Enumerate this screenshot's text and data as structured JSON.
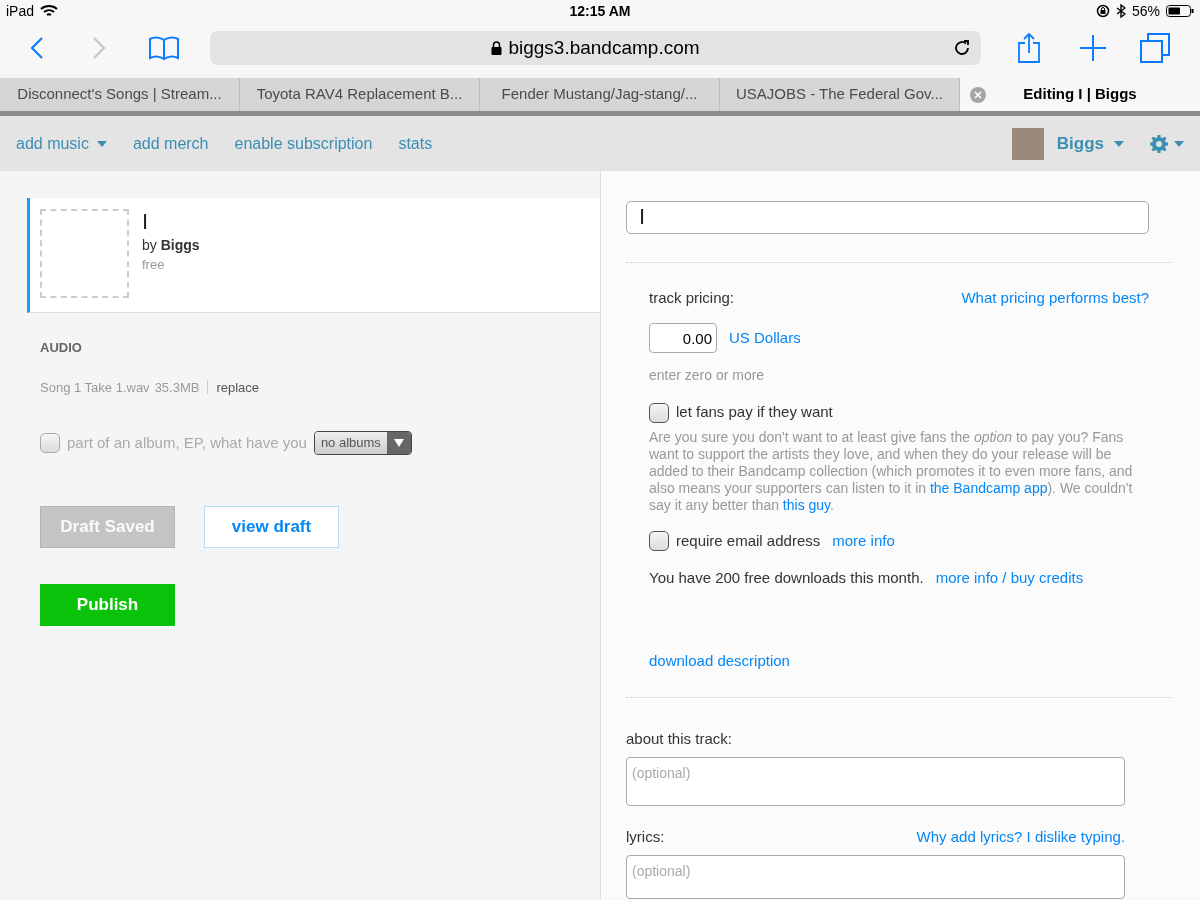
{
  "status_bar": {
    "device": "iPad",
    "time": "12:15 AM",
    "battery": "56%"
  },
  "browser": {
    "url": "biggs3.bandcamp.com"
  },
  "tabs": [
    {
      "label": "Disconnect's Songs | Stream...",
      "selected": false
    },
    {
      "label": "Toyota RAV4 Replacement B...",
      "selected": false
    },
    {
      "label": "Fender Mustang/Jag-stang/...",
      "selected": false
    },
    {
      "label": "USAJOBS - The Federal Gov...",
      "selected": false
    },
    {
      "label": "Editing I | Biggs",
      "selected": true
    }
  ],
  "nav": {
    "items": [
      {
        "label": "add music",
        "dropdown": true
      },
      {
        "label": "add merch",
        "dropdown": false
      },
      {
        "label": "enable subscription",
        "dropdown": false
      },
      {
        "label": "stats",
        "dropdown": false
      }
    ],
    "user": "Biggs"
  },
  "track_card": {
    "title": "I",
    "by": "by **Biggs**",
    "price": "free"
  },
  "audio": {
    "heading": "AUDIO",
    "file": "Song 1 Take 1.wav",
    "size": "35.3MB",
    "replace": "replace"
  },
  "album": {
    "label": "part of an album, EP, what have you",
    "checked": false,
    "disabled": true,
    "select": "no albums"
  },
  "buttons": {
    "draft": {
      "label": "Draft Saved",
      "disabled": true
    },
    "view": "view draft",
    "publish": "Publish"
  },
  "title_field": {
    "value": "I"
  },
  "pricing": {
    "label": "track pricing:",
    "help_link": "What pricing performs best?",
    "amount": "0.00",
    "currency": "US Dollars",
    "hint": "enter zero or more"
  },
  "options": [
    {
      "label": "let fans pay if they want",
      "checked": false
    },
    {
      "label": "require email address",
      "checked": false,
      "link": "more info"
    }
  ],
  "pay_note": [
    {
      "kind": "text",
      "text": "Are you sure you don't want to at least give fans the *option* to pay you? Fans want to support the artists they love, and when they do your release will be added to their Bandcamp collection (which promotes it to even more fans, and also means your supporters can listen to it in "
    },
    {
      "kind": "link",
      "text": "the Bandcamp app"
    },
    {
      "kind": "text",
      "text": "). We couldn't say it any better than "
    },
    {
      "kind": "link",
      "text": "this guy"
    },
    {
      "kind": "text",
      "text": "."
    }
  ],
  "downloads": {
    "text": "You have 200 free downloads this month.",
    "link": "more info / buy credits"
  },
  "download_description": "download description",
  "about": {
    "label": "about this track:",
    "placeholder": "(optional)"
  },
  "lyrics": {
    "label": "lyrics:",
    "link": "Why add lyrics? I dislike typing.",
    "placeholder": "(optional)"
  }
}
